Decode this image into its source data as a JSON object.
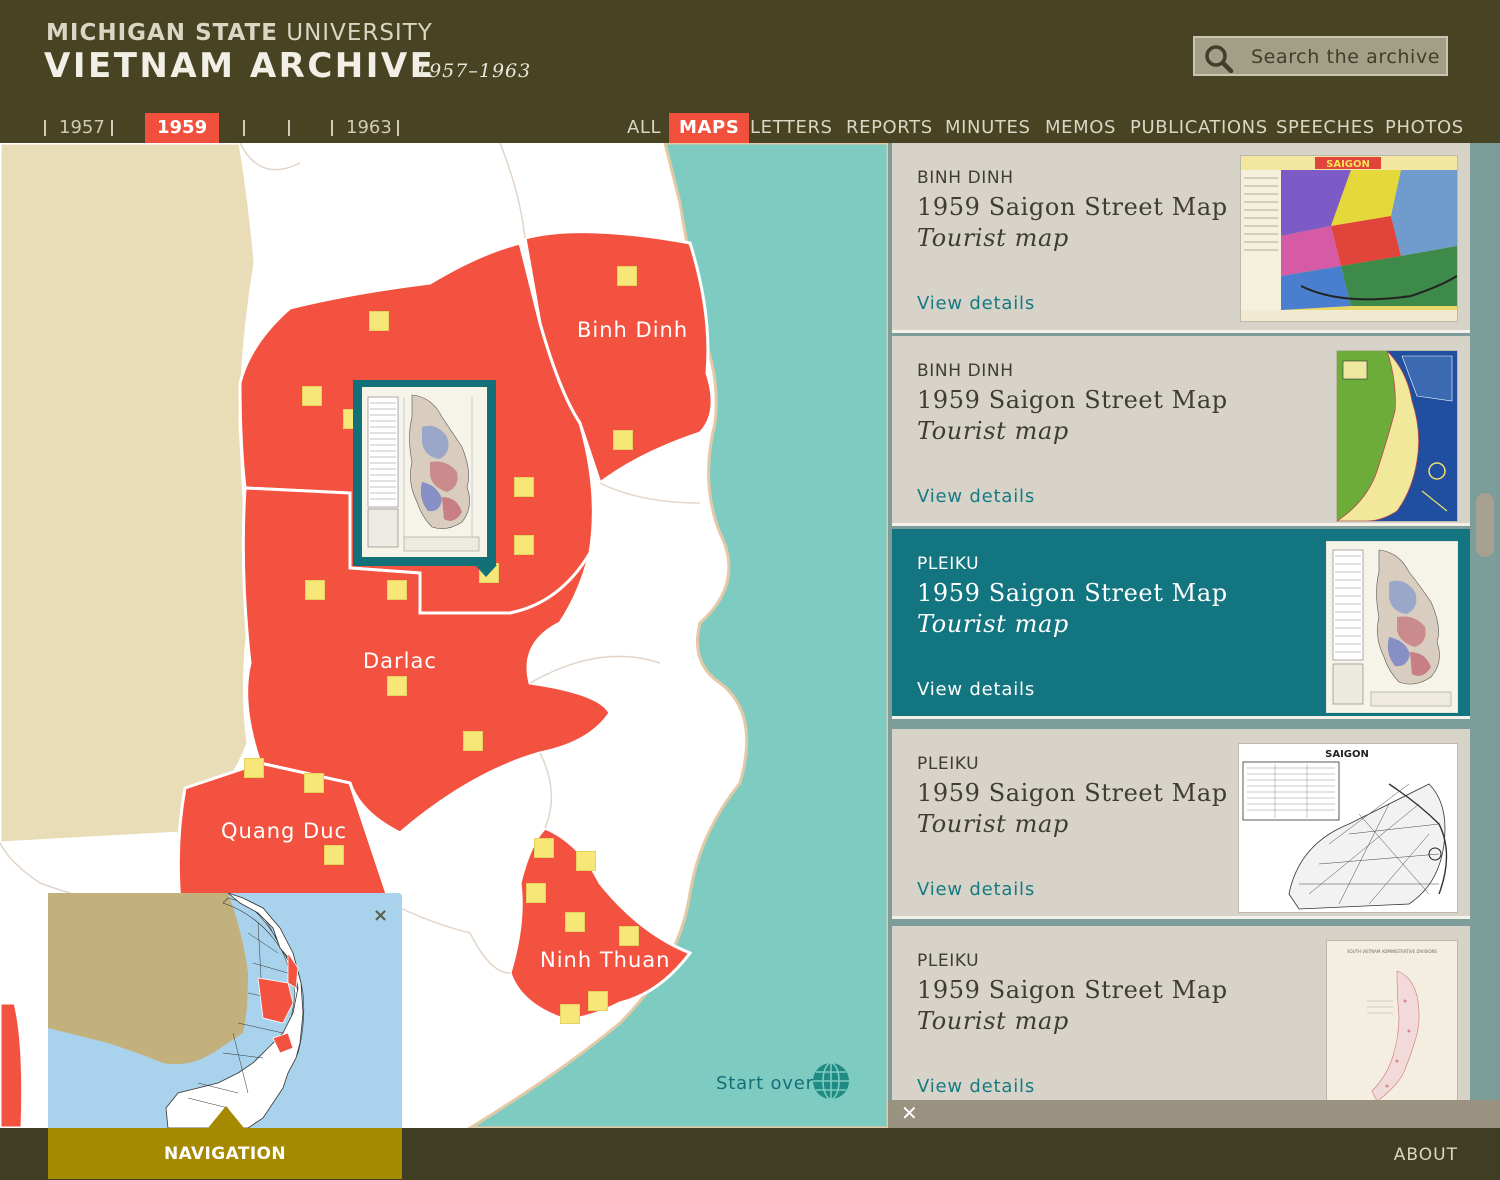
{
  "header": {
    "brand_line1_bold": "MICHIGAN STATE",
    "brand_line1_rest": " UNIVERSITY",
    "brand_line2": "VIETNAM ARCHIVE",
    "years_span": "1957–1963",
    "search_placeholder": "Search the archive"
  },
  "years": [
    "1957",
    "1959",
    "1963"
  ],
  "active_year": "1959",
  "filters": [
    "ALL",
    "MAPS",
    "LETTERS",
    "REPORTS",
    "MINUTES",
    "MEMOS",
    "PUBLICATIONS",
    "SPEECHES",
    "PHOTOS"
  ],
  "active_filter": "MAPS",
  "map": {
    "regions": [
      "Binh Dinh",
      "Darlac",
      "Quang Duc",
      "Ninh Thuan"
    ],
    "start_over": "Start over",
    "colors": {
      "region": "#f35240",
      "sea": "#7ecbc2",
      "land": "#e9ddb8",
      "marker": "#f6e778"
    }
  },
  "navigation": {
    "label": "NAVIGATION",
    "close_icon": "×"
  },
  "footer": {
    "about": "ABOUT"
  },
  "results": [
    {
      "place": "BINH DINH",
      "title": "1959 Saigon Street Map",
      "subtitle": "Tourist map",
      "link": "View details",
      "active": false
    },
    {
      "place": "BINH DINH",
      "title": "1959 Saigon Street Map",
      "subtitle": "Tourist map",
      "link": "View details",
      "active": false
    },
    {
      "place": "PLEIKU",
      "title": "1959 Saigon Street Map",
      "subtitle": "Tourist map",
      "link": "View details",
      "active": true
    },
    {
      "place": "PLEIKU",
      "title": "1959 Saigon Street Map",
      "subtitle": "Tourist map",
      "link": "View details",
      "active": false
    },
    {
      "place": "PLEIKU",
      "title": "1959 Saigon Street Map",
      "subtitle": "Tourist map",
      "link": "View details",
      "active": false
    }
  ],
  "thumb_texts": {
    "saigon_banner": "SAIGON",
    "saigon_plan": "SAIGON",
    "admin_title": "SOUTH VIETNAM ADMINISTRATIVE DIVISIONS"
  }
}
